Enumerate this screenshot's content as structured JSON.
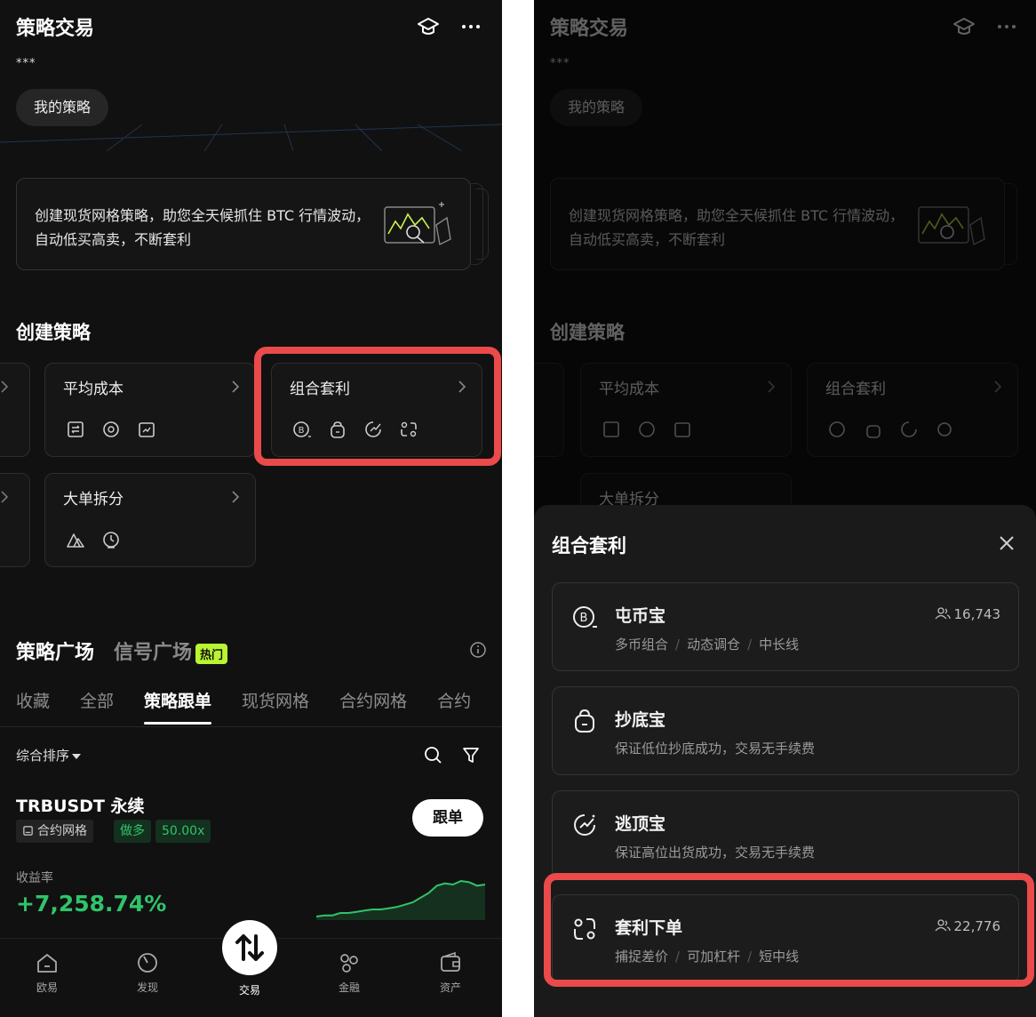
{
  "header": {
    "title": "策略交易",
    "subtitle": "***",
    "my_strategy": "我的策略"
  },
  "banner": {
    "text": "创建现货网格策略，助您全天候抓住 BTC 行情波动，自动低买高卖，不断套利"
  },
  "create": {
    "title": "创建策略",
    "cards": [
      {
        "title": "平均成本",
        "icons": [
          "swap-doc-icon",
          "cycle-coin-icon",
          "calendar-chart-icon"
        ]
      },
      {
        "title": "组合套利",
        "icons": [
          "bitcoin-coin-icon",
          "bag-icon",
          "rocket-arrow-icon",
          "loop-arrow-icon"
        ]
      },
      {
        "title": "大单拆分",
        "icons": [
          "triangle-split-icon",
          "clock-icon"
        ]
      }
    ]
  },
  "plaza": {
    "tab_active": "策略广场",
    "tab_other": "信号广场",
    "hot_badge": "热门",
    "subtabs": [
      "收藏",
      "全部",
      "策略跟单",
      "现货网格",
      "合约网格",
      "合约"
    ],
    "active_subtab": 2,
    "sort_label": "综合排序"
  },
  "listing": {
    "pair": "TRBUSDT 永续",
    "tag_type": "合约网格",
    "tag_side": "做多",
    "tag_leverage": "50.00x",
    "follow_label": "跟单",
    "yield_label": "收益率",
    "yield_value": "+7,258.74%",
    "spark": [
      4,
      5,
      5,
      7,
      7,
      8,
      9,
      10,
      10,
      11,
      12,
      14,
      16,
      20,
      24,
      30,
      32,
      31,
      34,
      33,
      30,
      31
    ]
  },
  "nav": {
    "items": [
      "欧易",
      "发现",
      "交易",
      "金融",
      "资产"
    ]
  },
  "sheet": {
    "title": "组合套利",
    "options": [
      {
        "icon": "bitcoin-coin-icon",
        "title": "屯币宝",
        "sub": [
          "多币组合",
          "动态调仓",
          "中长线"
        ],
        "count": "16,743"
      },
      {
        "icon": "bag-icon",
        "title": "抄底宝",
        "sub": [
          "保证低位抄底成功，交易无手续费"
        ],
        "count": ""
      },
      {
        "icon": "rocket-arrow-icon",
        "title": "逃顶宝",
        "sub": [
          "保证高位出货成功，交易无手续费"
        ],
        "count": ""
      },
      {
        "icon": "loop-arrow-icon",
        "title": "套利下单",
        "sub": [
          "捕捉差价",
          "可加杠杆",
          "短中线"
        ],
        "count": "22,776"
      }
    ],
    "separator": "/"
  },
  "colors": {
    "highlight": "#ea4a4a",
    "positive": "#30c46a",
    "hot": "#b9f531"
  }
}
